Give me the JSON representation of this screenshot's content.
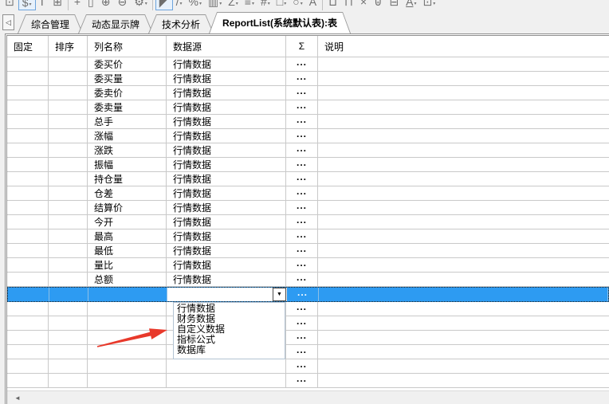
{
  "toolbar": {
    "icons": [
      {
        "name": "window-icon",
        "glyph": "⊡"
      },
      {
        "name": "currency-format-icon",
        "glyph": "$",
        "cls": "hl",
        "caret": "▾"
      },
      {
        "name": "field-list-icon",
        "glyph": "T"
      },
      {
        "name": "column-order-icon",
        "glyph": "⊞"
      },
      {
        "name": "toolbar-separator",
        "glyph": "",
        "cls": "sep"
      },
      {
        "name": "move-tool-icon",
        "glyph": "+"
      },
      {
        "name": "ruler-icon",
        "glyph": "▯"
      },
      {
        "name": "zoom-in-icon",
        "glyph": "⊕"
      },
      {
        "name": "zoom-out-icon",
        "glyph": "⊖"
      },
      {
        "name": "settings-gear-icon",
        "glyph": "⚙",
        "caret": "▾"
      },
      {
        "name": "toolbar-separator",
        "glyph": "",
        "cls": "sep"
      },
      {
        "name": "select-cursor-icon",
        "glyph": "◤",
        "cls": "hl"
      },
      {
        "name": "line-tool-icon",
        "glyph": "/",
        "caret": "▾"
      },
      {
        "name": "percent-format-icon",
        "glyph": "%",
        "caret": "▾"
      },
      {
        "name": "grid-style-icon",
        "glyph": "▥",
        "caret": "▾"
      },
      {
        "name": "z-order-icon",
        "glyph": "Z",
        "caret": "▾"
      },
      {
        "name": "align-icon",
        "glyph": "≡",
        "caret": "▾"
      },
      {
        "name": "border-grid-icon",
        "glyph": "#",
        "caret": "▾"
      },
      {
        "name": "rectangle-tool-icon",
        "glyph": "□",
        "caret": "▾"
      },
      {
        "name": "ellipse-tool-icon",
        "glyph": "○",
        "caret": "▾"
      },
      {
        "name": "text-tool-icon",
        "glyph": "A"
      },
      {
        "name": "toolbar-separator",
        "glyph": "",
        "cls": "sep"
      },
      {
        "name": "paste-icon",
        "glyph": "⊔"
      },
      {
        "name": "copy-icon",
        "glyph": "⊓"
      },
      {
        "name": "delete-icon",
        "glyph": "×"
      },
      {
        "name": "trash-icon",
        "glyph": "⊎"
      },
      {
        "name": "remove-field-icon",
        "glyph": "⊟"
      },
      {
        "name": "font-color-icon",
        "glyph": "A",
        "cls": "ul",
        "caret": "▾"
      },
      {
        "name": "cell-format-icon",
        "glyph": "⊡",
        "caret": "▾"
      }
    ]
  },
  "tabs": {
    "scroll_left_glyph": "◁",
    "items": [
      {
        "label": "综合管理",
        "name": "tab-comprehensive-management"
      },
      {
        "label": "动态显示牌",
        "name": "tab-dynamic-display-board"
      },
      {
        "label": "技术分析",
        "name": "tab-technical-analysis"
      },
      {
        "label": "ReportList(系统默认表):表",
        "name": "tab-reportlist-system-default",
        "cls": "active"
      }
    ]
  },
  "grid": {
    "headers": [
      "固定",
      "排序",
      "列名称",
      "数据源",
      "Σ",
      "说明"
    ],
    "rows": [
      {
        "name": "委买价",
        "source": "行情数据",
        "sigma": "..."
      },
      {
        "name": "委买量",
        "source": "行情数据",
        "sigma": "..."
      },
      {
        "name": "委卖价",
        "source": "行情数据",
        "sigma": "..."
      },
      {
        "name": "委卖量",
        "source": "行情数据",
        "sigma": "..."
      },
      {
        "name": "总手",
        "source": "行情数据",
        "sigma": "..."
      },
      {
        "name": "涨幅",
        "source": "行情数据",
        "sigma": "..."
      },
      {
        "name": "涨跌",
        "source": "行情数据",
        "sigma": "..."
      },
      {
        "name": "振幅",
        "source": "行情数据",
        "sigma": "..."
      },
      {
        "name": "持仓量",
        "source": "行情数据",
        "sigma": "..."
      },
      {
        "name": "仓差",
        "source": "行情数据",
        "sigma": "..."
      },
      {
        "name": "结算价",
        "source": "行情数据",
        "sigma": "..."
      },
      {
        "name": "今开",
        "source": "行情数据",
        "sigma": "..."
      },
      {
        "name": "最高",
        "source": "行情数据",
        "sigma": "..."
      },
      {
        "name": "最低",
        "source": "行情数据",
        "sigma": "..."
      },
      {
        "name": "量比",
        "source": "行情数据",
        "sigma": "..."
      },
      {
        "name": "总额",
        "source": "行情数据",
        "sigma": "..."
      }
    ],
    "selected_row": {
      "combobox_value": "",
      "dropdown_button_glyph": "▼",
      "sigma": "..."
    },
    "empty_rows": [
      {
        "sigma": "..."
      },
      {
        "sigma": "..."
      },
      {
        "sigma": "..."
      },
      {
        "sigma": "..."
      },
      {
        "sigma": "..."
      },
      {
        "sigma": "..."
      }
    ]
  },
  "dropdown_list": {
    "items": [
      "行情数据",
      "财务数据",
      "自定义数据",
      "指标公式",
      "数据库"
    ]
  },
  "scrollbar": {
    "left_arrow_glyph": "◄"
  },
  "colors": {
    "selection": "#2d9bf2",
    "arrow": "#e8392b"
  }
}
